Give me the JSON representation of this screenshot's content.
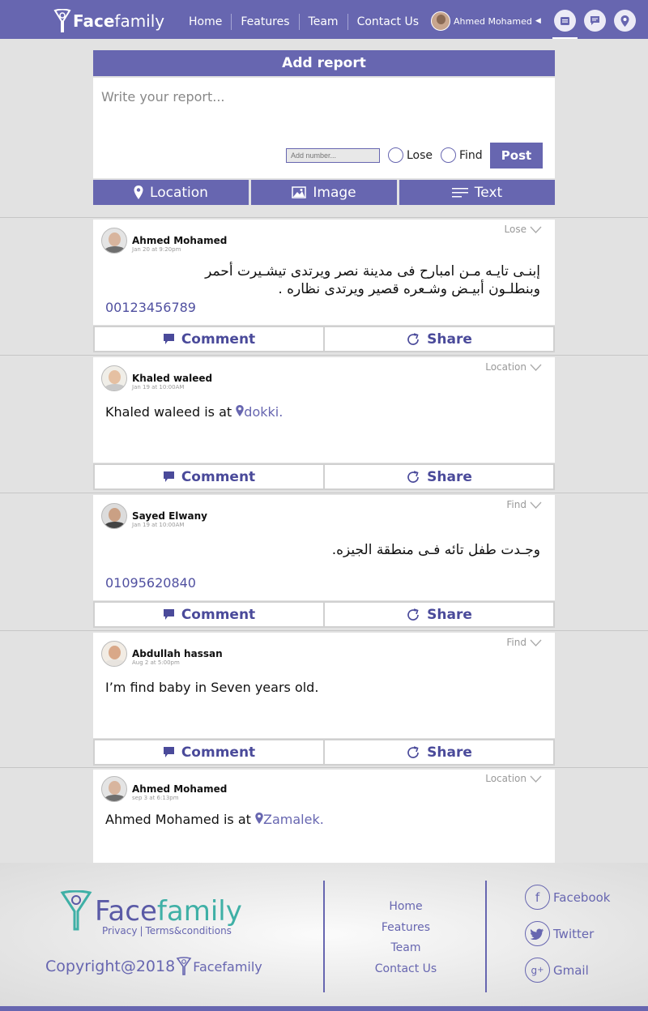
{
  "nav": {
    "brand_face": "Face",
    "brand_family": "family",
    "links": [
      "Home",
      "Features",
      "Team",
      "Contact Us"
    ],
    "user_name": "Ahmed Mohamed",
    "icons": [
      "calendar-icon",
      "chat-icon",
      "location-pin-icon"
    ]
  },
  "report": {
    "title": "Add report",
    "placeholder": "Write your report...",
    "number_placeholder": "Add number...",
    "option_lose": "Lose",
    "option_find": "Find",
    "post_label": "Post",
    "tab_location": "Location",
    "tab_image": "Image",
    "tab_text": "Text"
  },
  "posts": [
    {
      "name": "Ahmed Mohamed",
      "time": "Jan 20 at 9:20pm",
      "type": "Lose",
      "text_line1": "إبنـى تايـه مـن امبارح فى مدينة نصر ويرتدى تيشـيرت أحمر",
      "text_line2": "وبنطلـون أبيـض وشـعره قصير ويرتدى نظاره .",
      "number": "00123456789"
    },
    {
      "name": "Khaled waleed",
      "time": "Jan 19 at 10:00AM",
      "type": "Location",
      "text": "Khaled waleed is at",
      "place": "dokki."
    },
    {
      "name": "Sayed Elwany",
      "time": "Jan 19 at 10:00AM",
      "type": "Find",
      "text": "وجـدت طفل تائه فـى منطقة الجيزه.",
      "number": "01095620840"
    },
    {
      "name": "Abdullah hassan",
      "time": "Aug 2 at 5:00pm",
      "type": "Find",
      "text": "I’m find baby in Seven years old."
    },
    {
      "name": "Ahmed Mohamed",
      "time": "sep 3 at 6:13pm",
      "type": "Location",
      "text": "Ahmed Mohamed is at",
      "place": "Zamalek."
    }
  ],
  "actions": {
    "comment": "Comment",
    "share": "Share"
  },
  "footer": {
    "brand_face": "Face",
    "brand_family": "family",
    "privacy": "Privacy",
    "terms": "Terms&conditions",
    "copyright": "Copyright@2018",
    "links": [
      "Home",
      "Features",
      "Team",
      "Contact Us"
    ],
    "social": [
      "Facebook",
      "Twitter",
      "Gmail"
    ]
  },
  "colors": {
    "primary": "#6766b0",
    "accent": "#3fb0a6",
    "background": "#e2e2e2"
  }
}
